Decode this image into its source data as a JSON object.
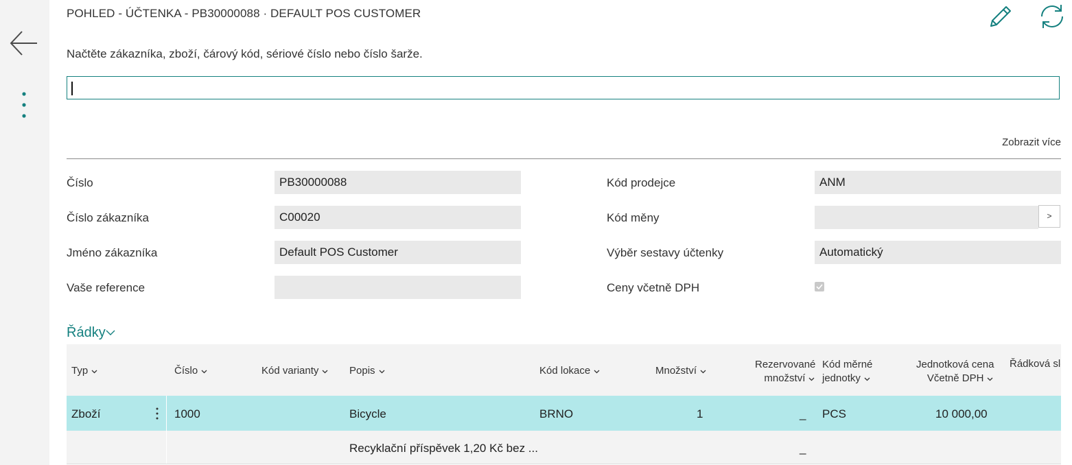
{
  "header": {
    "title": "POHLED - ÚČTENKA - PB30000088 · DEFAULT POS CUSTOMER",
    "back_icon": "arrow-left-icon",
    "more_icon": "kebab-vertical-icon",
    "edit_icon": "pencil-icon",
    "refresh_icon": "refresh-icon"
  },
  "scan": {
    "instruction": "Načtěte zákazníka, zboží, čárový kód, sériové číslo nebo číslo šarže.",
    "value": ""
  },
  "show_more": "Zobrazit více",
  "fields": {
    "cislo": {
      "label": "Číslo",
      "value": "PB30000088"
    },
    "cislo_zakaznika": {
      "label": "Číslo zákazníka",
      "value": "C00020"
    },
    "jmeno_zakaznika": {
      "label": "Jméno zákazníka",
      "value": "Default POS Customer"
    },
    "vase_reference": {
      "label": "Vaše reference",
      "value": ""
    },
    "kod_prodejce": {
      "label": "Kód prodejce",
      "value": "ANM"
    },
    "kod_meny": {
      "label": "Kód měny",
      "value": "",
      "lookup": ">"
    },
    "vyber_sestavy": {
      "label": "Výběr sestavy účtenky",
      "value": "Automatický"
    },
    "ceny_vcetne_dph": {
      "label": "Ceny včetně DPH",
      "checked": true
    }
  },
  "lines": {
    "title": "Řádky",
    "columns": {
      "typ": "Typ",
      "cislo": "Číslo",
      "kod_varianty": "Kód varianty",
      "popis": "Popis",
      "kod_lokace": "Kód lokace",
      "mnozstvi": "Množství",
      "rezervovane_1": "Rezervované",
      "rezervovane_2": "množství",
      "kod_merne_1": "Kód měrné",
      "kod_merne_2": "jednotky",
      "jednotkova_1": "Jednotková cena",
      "jednotkova_2": "Včetně DPH",
      "radkova": "Řádková sle"
    },
    "rows": [
      {
        "typ": "Zboží",
        "cislo": "1000",
        "kod_varianty": "",
        "popis": "Bicycle",
        "kod_lokace": "BRNO",
        "mnozstvi": "1",
        "rezervovane": "_",
        "kod_merne": "PCS",
        "jednotkova": "10 000,00"
      },
      {
        "typ": "",
        "cislo": "",
        "kod_varianty": "",
        "popis": "Recyklační příspěvek 1,20 Kč bez ...",
        "kod_lokace": "",
        "mnozstvi": "",
        "rezervovane": "_",
        "kod_merne": "",
        "jednotkova": ""
      }
    ]
  },
  "colors": {
    "accent": "#14807f",
    "selected_row": "#b2e8ea",
    "field_bg": "#e9e9e9",
    "sidebar_bg": "#f3f3f3"
  }
}
